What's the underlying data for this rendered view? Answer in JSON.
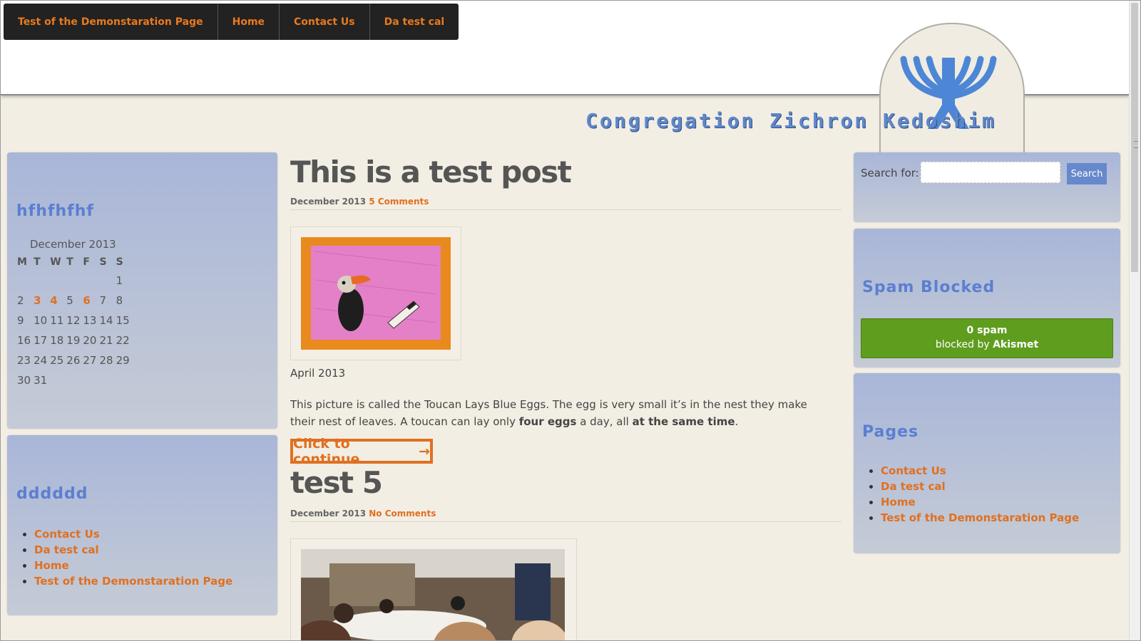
{
  "nav": {
    "items": [
      "Test of the Demonstaration Page",
      "Home",
      "Contact Us",
      "Da test cal"
    ]
  },
  "site": {
    "title": "Congregation Zichron Kedoshim"
  },
  "sidebar_left": {
    "calendar_widget": {
      "title": "hfhfhfhf",
      "caption": "December 2013",
      "weekdays": [
        "M",
        "T",
        "W",
        "T",
        "F",
        "S",
        "S"
      ],
      "weeks": [
        [
          "",
          "",
          "",
          "",
          "",
          "",
          "1"
        ],
        [
          "2",
          "3",
          "4",
          "5",
          "6",
          "7",
          "8"
        ],
        [
          "9",
          "10",
          "11",
          "12",
          "13",
          "14",
          "15"
        ],
        [
          "16",
          "17",
          "18",
          "19",
          "20",
          "21",
          "22"
        ],
        [
          "23",
          "24",
          "25",
          "26",
          "27",
          "28",
          "29"
        ],
        [
          "30",
          "31",
          "",
          "",
          "",
          "",
          ""
        ]
      ],
      "linked_days": [
        "3",
        "4",
        "6"
      ]
    },
    "pages_widget": {
      "title": "dddddd",
      "items": [
        "Contact Us",
        "Da test cal",
        "Home",
        "Test of the Demonstaration Page"
      ]
    }
  },
  "posts": [
    {
      "title": "This is a test post",
      "date": "December 2013",
      "comments": "5 Comments",
      "caption": "April 2013",
      "text_start": "This picture is called the Toucan Lays Blue Eggs. The egg is very small it’s in the nest they make their nest of leaves. A toucan can lay only ",
      "bold1": "four eggs",
      "text_mid": " a day, all ",
      "bold2": "at the same time",
      "text_end": ".",
      "continue": "Click to continue",
      "continue_arrow": "→"
    },
    {
      "title": "test 5",
      "date": "December 2013",
      "comments": "No Comments"
    }
  ],
  "sidebar_right": {
    "search": {
      "label": "Search for:",
      "button": "Search",
      "value": ""
    },
    "spam": {
      "title": "Spam Blocked",
      "count": "0 spam",
      "blocked_by": "blocked by",
      "brand": "Akismet"
    },
    "pages": {
      "title": "Pages",
      "items": [
        "Contact Us",
        "Da test cal",
        "Home",
        "Test of the Demonstaration Page"
      ]
    }
  },
  "colors": {
    "accent": "#e07020",
    "nav_bg": "#222222",
    "widget_title": "#5b7fd0",
    "akismet_green": "#5f9d1e"
  }
}
